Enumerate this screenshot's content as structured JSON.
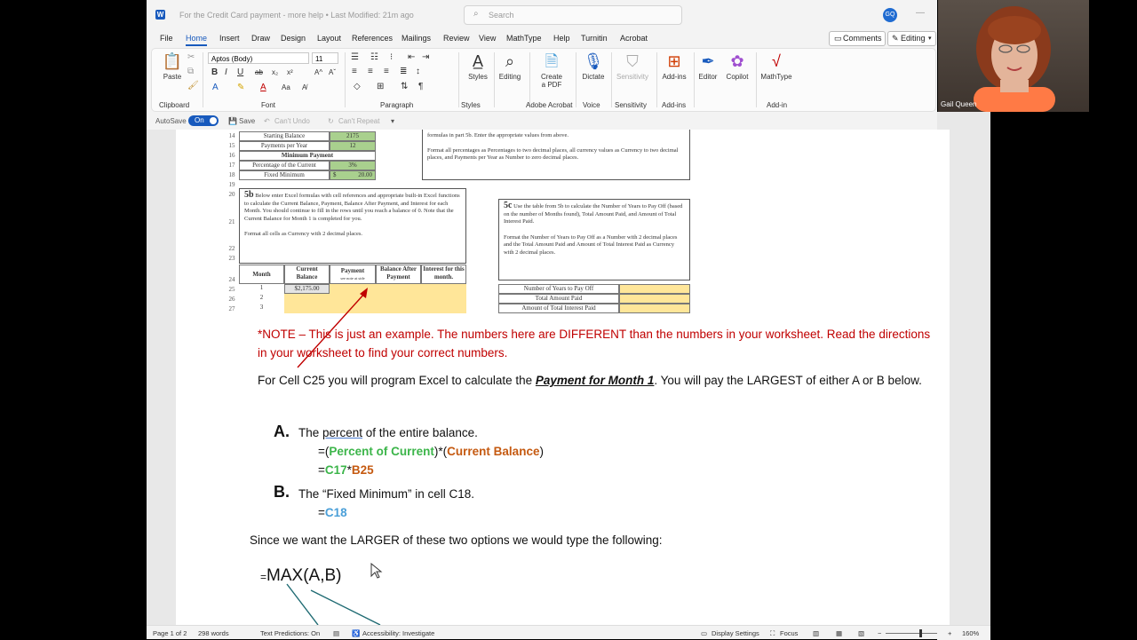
{
  "titlebar": {
    "doc_title": "For the Credit Card payment - more help • Last Modified: 21m ago",
    "search_placeholder": "Search",
    "avatar_initials": "GQ",
    "minimize_glyph": "—"
  },
  "menu": {
    "items": [
      "File",
      "Home",
      "Insert",
      "Draw",
      "Design",
      "Layout",
      "References",
      "Mailings",
      "Review",
      "View",
      "MathType",
      "Help",
      "Turnitin",
      "Acrobat"
    ],
    "comments": "Comments",
    "editing": "Editing"
  },
  "ribbon": {
    "paste": "Paste",
    "font_name": "Aptos (Body)",
    "font_size": "11",
    "styles": "Styles",
    "editing": "Editing",
    "create_pdf_1": "Create",
    "create_pdf_2": "a PDF",
    "dictate": "Dictate",
    "sensitivity": "Sensitivity",
    "addins": "Add-ins",
    "editor": "Editor",
    "copilot": "Copilot",
    "mathtype": "MathType",
    "groups": {
      "clipboard": "Clipboard",
      "font": "Font",
      "paragraph": "Paragraph",
      "styles": "Styles",
      "adobe": "Adobe Acrobat",
      "voice": "Voice",
      "sensitivity": "Sensitivity",
      "addins": "Add-ins",
      "addin": "Add-in"
    }
  },
  "qat": {
    "autosave": "AutoSave",
    "toggle": "On",
    "save": "Save",
    "undo": "Can't Undo",
    "repeat": "Can't Repeat"
  },
  "sheet": {
    "rows": [
      "14",
      "15",
      "16",
      "17",
      "18",
      "19",
      "20",
      "21",
      "22",
      "23",
      "24",
      "25",
      "26",
      "27"
    ],
    "labels": {
      "starting_balance": "Starting Balance",
      "starting_balance_val": "2175",
      "payments_per_year": "Payments per Year",
      "payments_per_year_val": "12",
      "minimum_payment": "Minimum Payment",
      "pct_current": "Percentage of the Current",
      "pct_current_val": "3%",
      "fixed_min": "Fixed Minimum",
      "fixed_min_cur": "$",
      "fixed_min_val": "20.00"
    },
    "top_note_1": "formulas in part 5b. Enter the appropriate values from above.",
    "top_note_2": "Format all percentages as Percentages to two decimal places, all currency values as Currency to two decimal places, and Payments per Year as Number to zero decimal places.",
    "box5b_head": "5b",
    "box5b_text": "Below enter Excel formulas with cell references and appropriate built-in Excel functions to calculate the Current Balance, Payment, Balance After Payment, and Interest for each Month. You should continue to fill in the rows until you reach a balance of 0. Note that the Current Balance for Month 1 is completed for you.",
    "box5b_format": "Format all cells as Currency with 2 decimal places.",
    "headers": [
      "Month",
      "Current Balance",
      "Payment",
      "Balance After Payment",
      "Interest for this month."
    ],
    "payment_sub": "see note at side",
    "months": [
      "1",
      "2",
      "3"
    ],
    "first_balance": "$2,175.00",
    "box5c_head": "5c",
    "box5c_text": "Use the table from 5b to calculate the Number of Years to Pay Off (based on the number of Months found), Total Amount Paid, and Amount of Total Interest Paid.",
    "box5c_format": "Format the Number of Years to Pay Off as a Number with 2 decimal places and the Total Amount Paid and Amount of Total Interest Paid as Currency with 2 decimal places.",
    "summary": [
      "Number of Years to Pay Off",
      "Total Amount Paid",
      "Amount of Total Interest Paid"
    ]
  },
  "doc": {
    "note": "*NOTE – This is just an example.  The numbers here are DIFFERENT than the numbers in your worksheet.  Read the directions in your worksheet to find your correct numbers.",
    "para1_a": "For Cell C25 you will program Excel to calculate the ",
    "para1_em": "Payment for Month 1",
    "para1_b": ".  You will pay the LARGEST of either A or B below.",
    "a_letter": "A.",
    "a_text_1": "The ",
    "a_text_percent": "percent",
    "a_text_2": " of the entire balance.",
    "a_f1_eq": "=(",
    "a_f1_g": "Percent of Current",
    "a_f1_mid": ")*(",
    "a_f1_o": "Current Balance",
    "a_f1_end": ")",
    "a_f2_eq": "=",
    "a_f2_g": "C17",
    "a_f2_mid": "*",
    "a_f2_o": "B25",
    "b_letter": "B.",
    "b_text": "The “Fixed Minimum” in cell C18.",
    "b_f_eq": "=",
    "b_f_b": "C18",
    "para2": "Since we want the LARGER of these two options we would type the following:",
    "max_eq": "=",
    "max_formula": "MAX(A,B)"
  },
  "status": {
    "page": "Page 1 of 2",
    "words": "298 words",
    "predictions": "Text Predictions: On",
    "accessibility": "Accessibility: Investigate",
    "display": "Display Settings",
    "focus": "Focus",
    "zoom": "160%",
    "minus": "−",
    "plus": "+"
  },
  "webcam": {
    "name": "Gail Queen"
  },
  "colors": {
    "accent": "#185abd",
    "note_red": "#c00000",
    "green_formula": "#3cb54a",
    "orange_formula": "#c55a11",
    "blue_formula": "#4a9fd8",
    "cell_green": "#a9d08e",
    "cell_yellow": "#ffe699"
  }
}
